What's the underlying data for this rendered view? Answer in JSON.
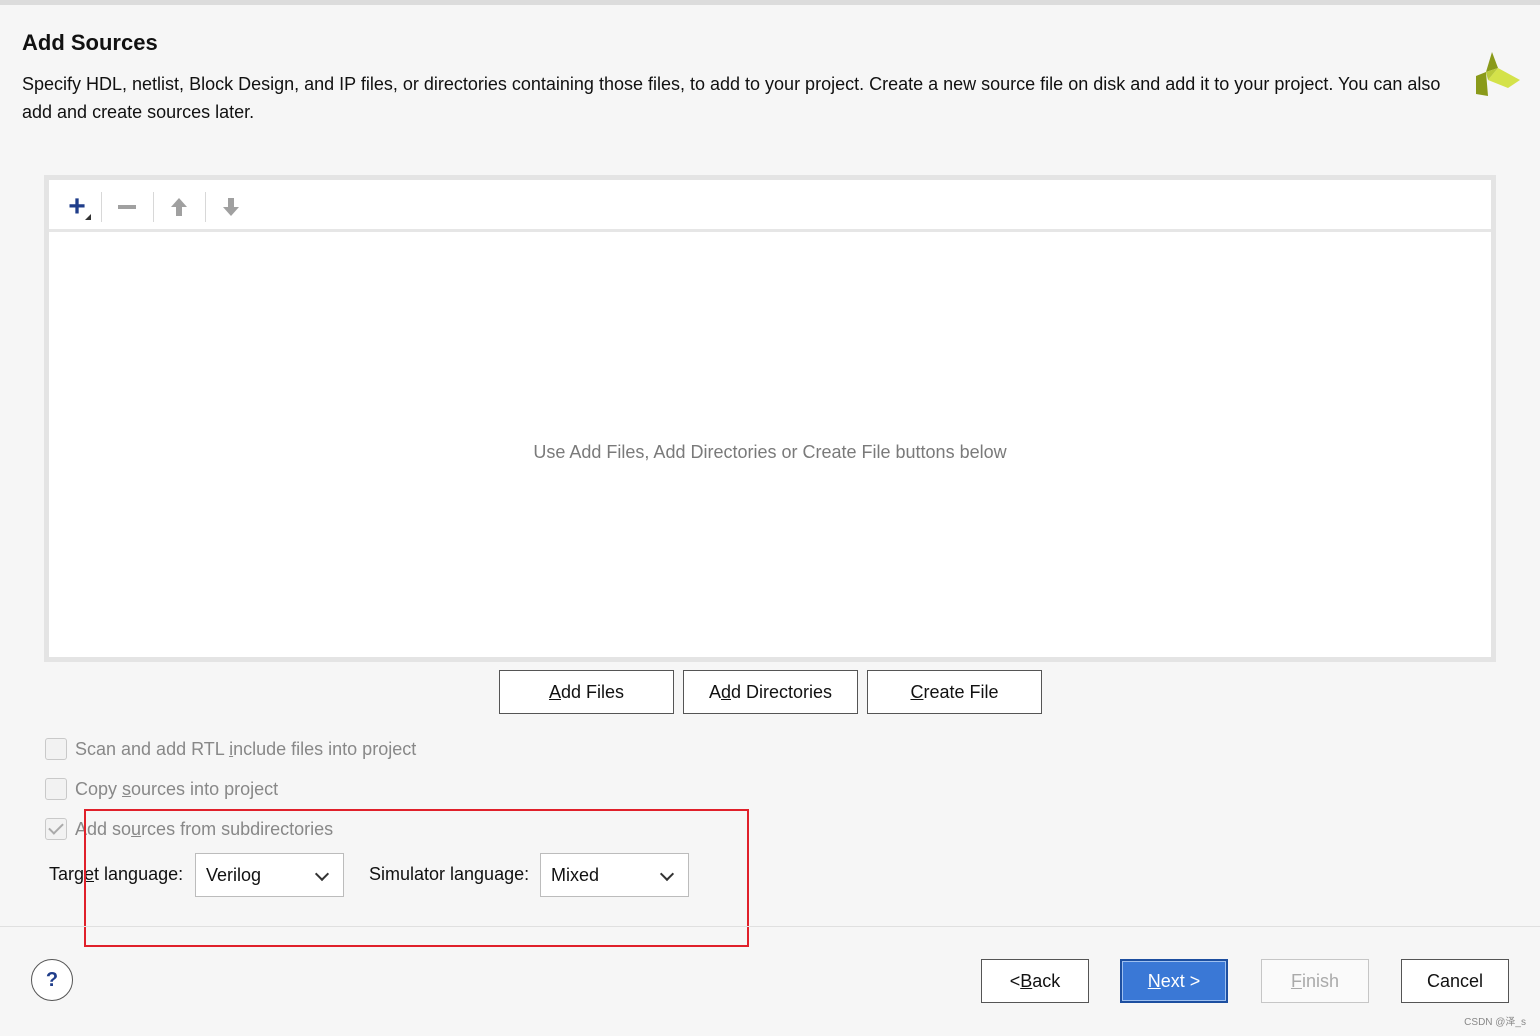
{
  "dialog": {
    "title": "Add Sources",
    "description": "Specify HDL, netlist, Block Design, and IP files, or directories containing those files, to add to your project. Create a new source file on disk and add it to your project. You can also add and create sources later."
  },
  "toolbar": {
    "add_icon": "plus-icon",
    "remove_icon": "minus-icon",
    "up_icon": "arrow-up-icon",
    "down_icon": "arrow-down-icon"
  },
  "file_list": {
    "empty_message": "Use Add Files, Add Directories or Create File buttons below"
  },
  "actions": {
    "add_files": {
      "pre": "",
      "key": "A",
      "post": "dd Files"
    },
    "add_directories": {
      "pre": "A",
      "key": "d",
      "post": "d Directories"
    },
    "create_file": {
      "pre": "",
      "key": "C",
      "post": "reate File"
    }
  },
  "options": {
    "scan_rtl": {
      "pre": "Scan and add RTL ",
      "key": "i",
      "post": "nclude files into project",
      "checked": false
    },
    "copy_sources": {
      "pre": "Copy ",
      "key": "s",
      "post": "ources into project",
      "checked": false
    },
    "add_subdirs": {
      "pre": "Add so",
      "key": "u",
      "post": "rces from subdirectories",
      "checked": true
    }
  },
  "languages": {
    "target_label_pre": "Targ",
    "target_label_key": "e",
    "target_label_post": "t language:",
    "target_value": "Verilog",
    "simulator_label": "Simulator language:",
    "simulator_value": "Mixed"
  },
  "footer": {
    "help_label": "?",
    "back": {
      "pre": "< ",
      "key": "B",
      "post": "ack"
    },
    "next": {
      "pre": "",
      "key": "N",
      "post": "ext >"
    },
    "finish": {
      "pre": "",
      "key": "F",
      "post": "inish"
    },
    "cancel": "Cancel"
  },
  "watermark": "CSDN @泽_s",
  "colors": {
    "accent": "#3a78d6",
    "highlight": "#e0202a",
    "logo_dark": "#8a9a1a",
    "logo_light": "#d4e24a"
  }
}
